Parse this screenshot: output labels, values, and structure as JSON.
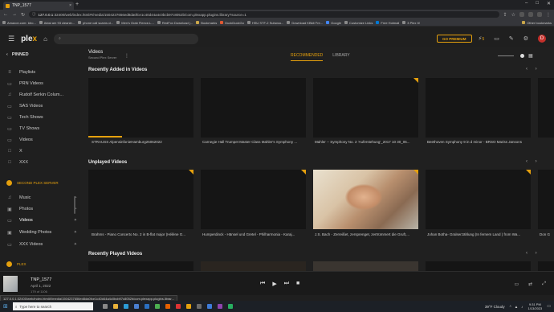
{
  "browser": {
    "tab_title": "TNP_1577",
    "tab_close": "×",
    "new_tab": "+",
    "window_controls": [
      "–",
      "□",
      "✕"
    ],
    "url_prefix": "127.0.0.1",
    "url_rest": ":32400/web/index.html#!/media/1504237656ed8da0fce1c40d44a4c0bcb97c8052b/com.plexapp.plugins.library?source=1",
    "bookmarks": [
      "Amazon.com: Idro...",
      "Aktai am 93 cleanin...",
      "phone call scams cl...",
      "Men's Grab Fleece-L...",
      "RedFox Download |...",
      "Bookmarks",
      "DuckDuckGo",
      "HSU STF-2 Subwoo...",
      "Download KBkit Fre...",
      "Google",
      "Customize Links",
      "Free Hotmail",
      "3 Plex It!"
    ],
    "bookmarks_right": "Other bookmarks"
  },
  "plex": {
    "logo_a": "ple",
    "logo_b": "x",
    "go_premium": "GO PREMIUM",
    "notifications": "5",
    "avatar_letter": "D"
  },
  "sidebar": {
    "pinned": "PINNED",
    "items": [
      "Playlists",
      "PRN Videos",
      "Rudolf Serkin Colum...",
      "SAS Videos",
      "Tech Shows",
      "TV Shows",
      "Videos",
      "X",
      "XXX"
    ],
    "server_header": "SECOND PLEX SERVER",
    "server_items": [
      "Music",
      "Photos",
      "Videos",
      "Wedding Photos",
      "XXX Videos"
    ],
    "plex_header": "PLEX"
  },
  "main": {
    "library_title": "Videos",
    "library_sub": "Second Plex Server",
    "more": "⋮",
    "tab_recommended": "RECOMMENDED",
    "tab_library": "LIBRARY",
    "sections": [
      {
        "title": "Recently Added in Videos",
        "captions": [
          "STRAUSS AlpensinfonieHamburg25062022",
          "Carnegie Hall Trumpet Master Class Mahler's Symphony ...",
          "Mahler -- Symphony No. 2 'Auferstehung'_2017 10 30_05...",
          "Beethoven Symphony 9 in d minor - BRSO Mariss Jansons",
          ""
        ]
      },
      {
        "title": "Unplayed Videos",
        "captions": [
          "Brahms - Piano Concerto No. 2 in B-flat major (Hélène G...",
          "Humperdinck - Hänsel und Gretel - Philharmonia - Karaj...",
          "J.S. Bach - Zerreißet, zersprenget, zertrümmert die Gruft,...",
          "Johan Botha- Gralserzählung (In fernem Land ) from Wa...",
          "Don G"
        ]
      },
      {
        "title": "Recently Played Videos",
        "captions": []
      }
    ]
  },
  "player": {
    "title": "TNP_1577",
    "date": "April 1, 2022",
    "count": "179 of 1106"
  },
  "status_url": "127.0.0.1:32400/web/index.html#!/media/1504237656ed8da0fce1c40d44a4c0bcb97c8052b/com.plexapp.plugins.librar...",
  "taskbar": {
    "search_placeholder": "Type here to search",
    "weather": "39°F  Cloudy",
    "time": "9:31 PM",
    "date": "1/13/2023"
  },
  "colors": {
    "accent": "#e5a00d",
    "background": "#1f1f1f"
  }
}
